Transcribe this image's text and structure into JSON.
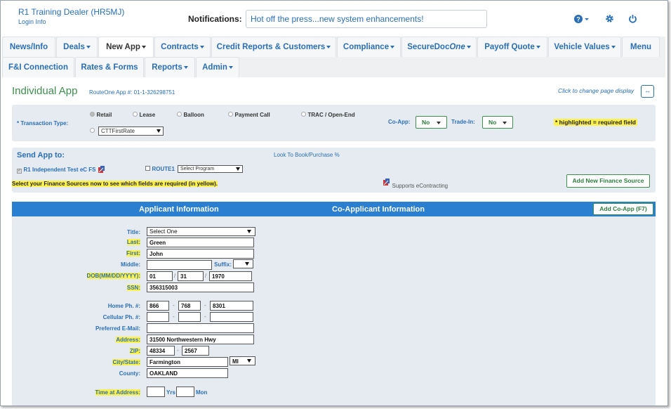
{
  "header": {
    "dealer_name": "R1 Training Dealer (HR5MJ)",
    "login_info": "Login Info",
    "notifications_label": "Notifications:",
    "notifications_text": "Hot off the press...new system enhancements!",
    "icons": [
      "help-icon",
      "gear-icon",
      "power-icon"
    ]
  },
  "nav": {
    "row1": [
      "News/Info",
      "Deals",
      "New App",
      "Contracts",
      "Credit Reports & Customers",
      "Compliance",
      "SecureDoc",
      "Payoff Quote",
      "Vehicle Values",
      "Menu"
    ],
    "securedoc_suffix": "One",
    "row2": [
      "F&I Connection",
      "Rates & Forms",
      "Reports",
      "Admin"
    ]
  },
  "page": {
    "title": "Individual App",
    "app_number": "RouteOne App #: 01-1-326298751",
    "click_change": "Click to change page display",
    "expand_symbol": "↔"
  },
  "transaction": {
    "label": "* Transaction Type:",
    "options": [
      "Retail",
      "Lease",
      "Balloon",
      "Payment Call",
      "TRAC / Open-End"
    ],
    "program_select": "CTTFirstRate",
    "coapp_label": "Co-App:",
    "coapp_value": "No",
    "tradein_label": "Trade-In:",
    "tradein_value": "No",
    "required_note": "* highlighted = required field"
  },
  "send_app": {
    "title": "Send App to:",
    "look_to_book": "Look To Book/Purchase %",
    "source1": "R1 Independent Test eC FS",
    "source2": "ROUTE1",
    "program_placeholder": "Select Program",
    "instruction": "Select your Finance Sources now to see which fields are required (in yellow).",
    "supports": "Supports eContracting",
    "add_button": "Add New Finance Source"
  },
  "applicant": {
    "header_applicant": "Applicant Information",
    "header_coapplicant": "Co-Applicant Information",
    "add_coapp": "Add Co-App  (F7)",
    "labels": {
      "title": "Title:",
      "last": "Last:",
      "first": "First:",
      "middle": "Middle:",
      "suffix": "Suffix:",
      "dob": "DOB(MM/DD/YYYY):",
      "ssn": "SSN:",
      "home_ph": "Home Ph. #:",
      "cell_ph": "Cellular Ph. #:",
      "email": "Preferred E-Mail:",
      "address": "Address:",
      "zip": "ZIP:",
      "city_state": "City/State:",
      "county": "County:",
      "time_at_address": "Time at Address:",
      "yrs": "Yrs",
      "mon": "Mon"
    },
    "values": {
      "title": "Select One",
      "last": "Green",
      "first": "John",
      "middle": "",
      "dob_mm": "01",
      "dob_dd": "31",
      "dob_yyyy": "1970",
      "ssn": "356315003",
      "home_area": "866",
      "home_prefix": "768",
      "home_line": "8301",
      "address": "31500 Northwestern Hwy",
      "zip": "48334",
      "zip4": "2567",
      "city": "Farmington",
      "state": "MI",
      "county": "OAKLAND"
    },
    "separators": {
      "slash": "/",
      "dash": "-"
    }
  },
  "colors": {
    "accent_blue": "#2a6fb5",
    "header_blue": "#2a7fd0",
    "green": "#3e8e4e",
    "required_yellow": "#fff24d",
    "panel": "#e6ebf1"
  }
}
